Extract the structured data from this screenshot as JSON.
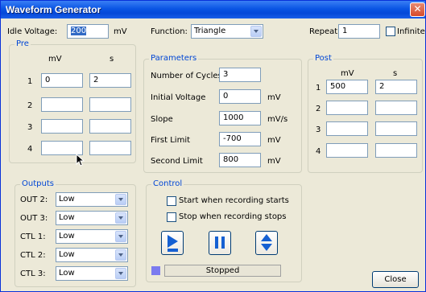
{
  "window": {
    "title": "Waveform Generator",
    "close_glyph": "✕"
  },
  "top": {
    "idle_label": "Idle Voltage:",
    "idle_value": "200",
    "idle_unit": "mV",
    "function_label": "Function:",
    "function_value": "Triangle",
    "repeat_label": "Repeat:",
    "repeat_value": "1",
    "infinite_label": "Infinite"
  },
  "pre": {
    "title": "Pre",
    "col_mv": "mV",
    "col_s": "s",
    "rows": [
      {
        "n": "1",
        "mv": "0",
        "s": "2"
      },
      {
        "n": "2",
        "mv": "",
        "s": ""
      },
      {
        "n": "3",
        "mv": "",
        "s": ""
      },
      {
        "n": "4",
        "mv": "",
        "s": ""
      }
    ]
  },
  "params": {
    "title": "Parameters",
    "rows": [
      {
        "label": "Number of Cycles:",
        "value": "3",
        "unit": ""
      },
      {
        "label": "Initial Voltage",
        "value": "0",
        "unit": "mV"
      },
      {
        "label": "Slope",
        "value": "1000",
        "unit": "mV/s"
      },
      {
        "label": "First Limit",
        "value": "-700",
        "unit": "mV"
      },
      {
        "label": "Second Limit",
        "value": "800",
        "unit": "mV"
      }
    ]
  },
  "post": {
    "title": "Post",
    "col_mv": "mV",
    "col_s": "s",
    "rows": [
      {
        "n": "1",
        "mv": "500",
        "s": "2"
      },
      {
        "n": "2",
        "mv": "",
        "s": ""
      },
      {
        "n": "3",
        "mv": "",
        "s": ""
      },
      {
        "n": "4",
        "mv": "",
        "s": ""
      }
    ]
  },
  "outputs": {
    "title": "Outputs",
    "rows": [
      {
        "label": "OUT 2:",
        "value": "Low"
      },
      {
        "label": "OUT 3:",
        "value": "Low"
      },
      {
        "label": "CTL 1:",
        "value": "Low"
      },
      {
        "label": "CTL 2:",
        "value": "Low"
      },
      {
        "label": "CTL 3:",
        "value": "Low"
      }
    ]
  },
  "control": {
    "title": "Control",
    "start_label": "Start when recording starts",
    "stop_label": "Stop when recording stops",
    "status": "Stopped",
    "status_color": "#7b7bef"
  },
  "footer": {
    "close_label": "Close"
  }
}
